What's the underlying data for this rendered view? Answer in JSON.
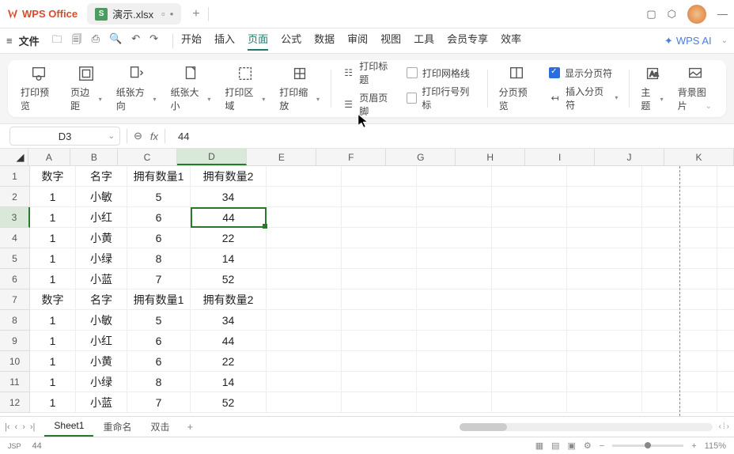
{
  "app": {
    "name": "WPS Office"
  },
  "tab": {
    "filename": "演示.xlsx",
    "prefix": "S"
  },
  "menubar": {
    "file": "文件",
    "items": [
      "开始",
      "插入",
      "页面",
      "公式",
      "数据",
      "审阅",
      "视图",
      "工具",
      "会员专享",
      "效率"
    ],
    "active_index": 2,
    "ai": "WPS AI"
  },
  "ribbon": {
    "print_preview": "打印预览",
    "margins": "页边距",
    "orientation": "纸张方向",
    "size": "纸张大小",
    "print_area": "打印区域",
    "print_scale": "打印缩放",
    "print_title": "打印标题",
    "header_footer": "页眉页脚",
    "gridlines": "打印网格线",
    "row_col_header": "打印行号列标",
    "page_preview": "分页预览",
    "insert_break": "插入分页符",
    "show_break": "显示分页符",
    "theme": "主题",
    "bg_image": "背景图片"
  },
  "namebox": "D3",
  "formula": "44",
  "columns": [
    "A",
    "B",
    "C",
    "D",
    "E",
    "F",
    "G",
    "H",
    "I",
    "J",
    "K"
  ],
  "row_labels": [
    "1",
    "2",
    "3",
    "4",
    "5",
    "6",
    "7",
    "8",
    "9",
    "10",
    "11",
    "12"
  ],
  "active_row_index": 2,
  "active_col_index": 3,
  "rows": [
    [
      "数字",
      "名字",
      "拥有数量1",
      "拥有数量2",
      "",
      "",
      "",
      "",
      "",
      "",
      ""
    ],
    [
      "1",
      "小敏",
      "5",
      "34",
      "",
      "",
      "",
      "",
      "",
      "",
      ""
    ],
    [
      "1",
      "小红",
      "6",
      "44",
      "",
      "",
      "",
      "",
      "",
      "",
      ""
    ],
    [
      "1",
      "小黄",
      "6",
      "22",
      "",
      "",
      "",
      "",
      "",
      "",
      ""
    ],
    [
      "1",
      "小绿",
      "8",
      "14",
      "",
      "",
      "",
      "",
      "",
      "",
      ""
    ],
    [
      "1",
      "小蓝",
      "7",
      "52",
      "",
      "",
      "",
      "",
      "",
      "",
      ""
    ],
    [
      "数字",
      "名字",
      "拥有数量1",
      "拥有数量2",
      "",
      "",
      "",
      "",
      "",
      "",
      ""
    ],
    [
      "1",
      "小敏",
      "5",
      "34",
      "",
      "",
      "",
      "",
      "",
      "",
      ""
    ],
    [
      "1",
      "小红",
      "6",
      "44",
      "",
      "",
      "",
      "",
      "",
      "",
      ""
    ],
    [
      "1",
      "小黄",
      "6",
      "22",
      "",
      "",
      "",
      "",
      "",
      "",
      ""
    ],
    [
      "1",
      "小绿",
      "8",
      "14",
      "",
      "",
      "",
      "",
      "",
      "",
      ""
    ],
    [
      "1",
      "小蓝",
      "7",
      "52",
      "",
      "",
      "",
      "",
      "",
      "",
      ""
    ]
  ],
  "sheets": {
    "tabs": [
      "Sheet1",
      "重命名",
      "双击"
    ],
    "active_index": 0
  },
  "status": {
    "mode": "JSP",
    "value": "44",
    "zoom": "115%"
  },
  "chart_data": {
    "type": "table",
    "columns": [
      "数字",
      "名字",
      "拥有数量1",
      "拥有数量2"
    ],
    "rows": [
      [
        1,
        "小敏",
        5,
        34
      ],
      [
        1,
        "小红",
        6,
        44
      ],
      [
        1,
        "小黄",
        6,
        22
      ],
      [
        1,
        "小绿",
        8,
        14
      ],
      [
        1,
        "小蓝",
        7,
        52
      ],
      [
        1,
        "小敏",
        5,
        34
      ],
      [
        1,
        "小红",
        6,
        44
      ],
      [
        1,
        "小黄",
        6,
        22
      ],
      [
        1,
        "小绿",
        8,
        14
      ],
      [
        1,
        "小蓝",
        7,
        52
      ]
    ]
  }
}
